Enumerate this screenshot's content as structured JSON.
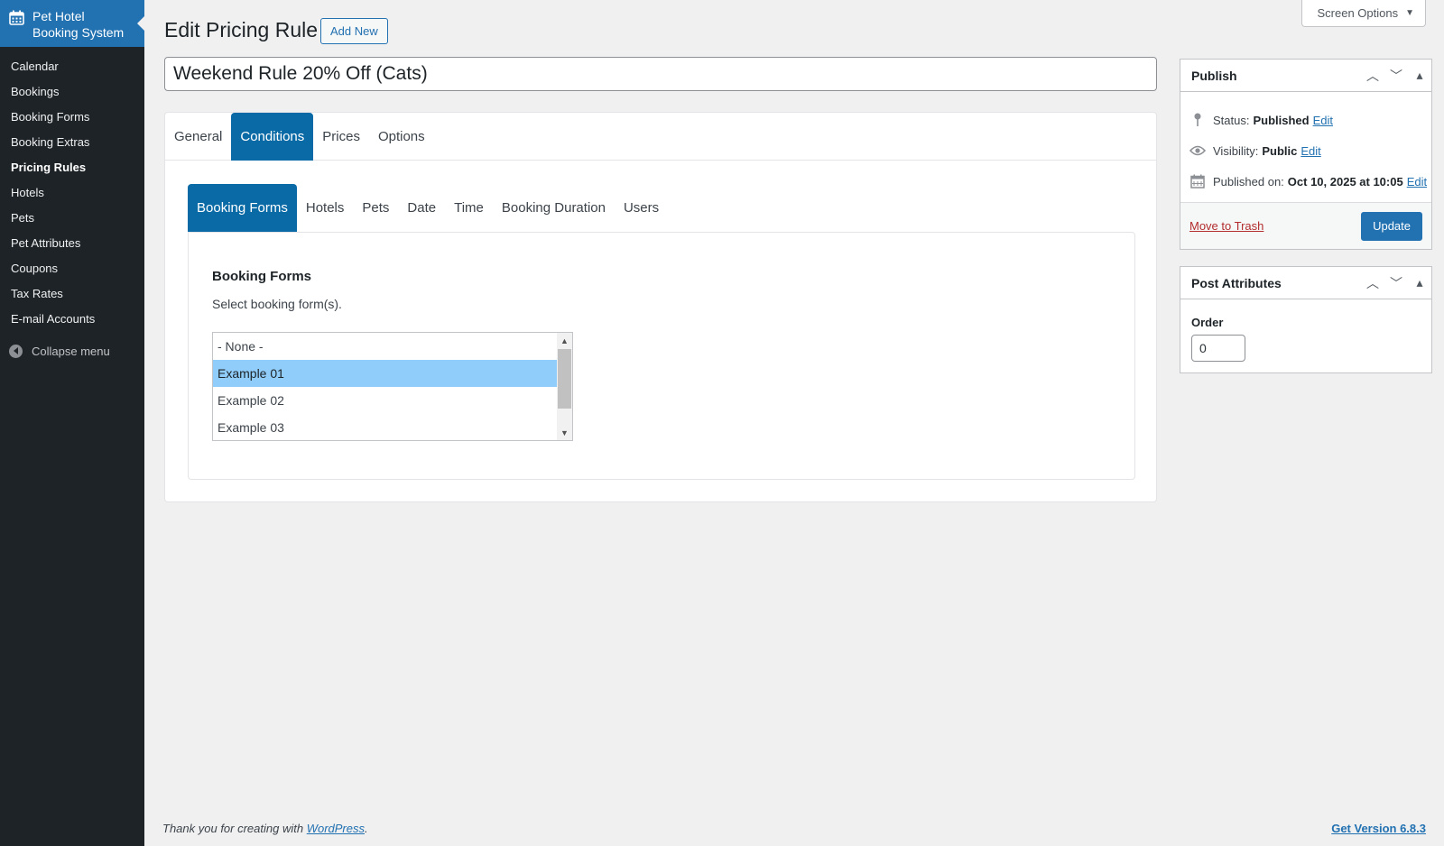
{
  "sidebar": {
    "brand_line1": "Pet Hotel",
    "brand_line2": "Booking System",
    "items": [
      {
        "label": "Calendar"
      },
      {
        "label": "Bookings"
      },
      {
        "label": "Booking Forms"
      },
      {
        "label": "Booking Extras"
      },
      {
        "label": "Pricing Rules"
      },
      {
        "label": "Hotels"
      },
      {
        "label": "Pets"
      },
      {
        "label": "Pet Attributes"
      },
      {
        "label": "Coupons"
      },
      {
        "label": "Tax Rates"
      },
      {
        "label": "E-mail Accounts"
      }
    ],
    "current_item": "Pricing Rules",
    "collapse_label": "Collapse menu"
  },
  "header": {
    "screen_options": "Screen Options",
    "title": "Edit Pricing Rule",
    "add_new": "Add New"
  },
  "post_title": "Weekend Rule 20% Off (Cats)",
  "tabs": [
    {
      "label": "General"
    },
    {
      "label": "Conditions"
    },
    {
      "label": "Prices"
    },
    {
      "label": "Options"
    }
  ],
  "active_tab": "Conditions",
  "subtabs": [
    {
      "label": "Booking Forms"
    },
    {
      "label": "Hotels"
    },
    {
      "label": "Pets"
    },
    {
      "label": "Date"
    },
    {
      "label": "Time"
    },
    {
      "label": "Booking Duration"
    },
    {
      "label": "Users"
    }
  ],
  "active_subtab": "Booking Forms",
  "section": {
    "title": "Booking Forms",
    "description": "Select booking form(s).",
    "options": [
      {
        "label": "- None -",
        "selected": false
      },
      {
        "label": "Example 01",
        "selected": true
      },
      {
        "label": "Example 02",
        "selected": false
      },
      {
        "label": "Example 03",
        "selected": false
      }
    ]
  },
  "publish": {
    "title": "Publish",
    "status_label": "Status:",
    "status_value": "Published",
    "visibility_label": "Visibility:",
    "visibility_value": "Public",
    "published_label": "Published on:",
    "published_value": "Oct 10, 2025 at 10:05",
    "edit_label": "Edit",
    "trash_label": "Move to Trash",
    "update_label": "Update"
  },
  "post_attributes": {
    "title": "Post Attributes",
    "order_label": "Order",
    "order_value": "0"
  },
  "footer": {
    "thanks_prefix": "Thank you for creating with ",
    "wordpress_link": "WordPress",
    "thanks_suffix": ".",
    "version_link": "Get Version 6.8.3"
  },
  "colors": {
    "sidebar_bg": "#1d2327",
    "brand_bg": "#2271b1",
    "active_tab_bg": "#0a6aa6",
    "selected_option_bg": "#90cdfa",
    "link": "#2271b1",
    "trash": "#b32d2e"
  },
  "icons": {
    "brand": "calendar-icon",
    "collapse": "collapse-arrow-icon",
    "status": "pin-icon",
    "visibility": "eye-icon",
    "published": "calendar-icon"
  }
}
